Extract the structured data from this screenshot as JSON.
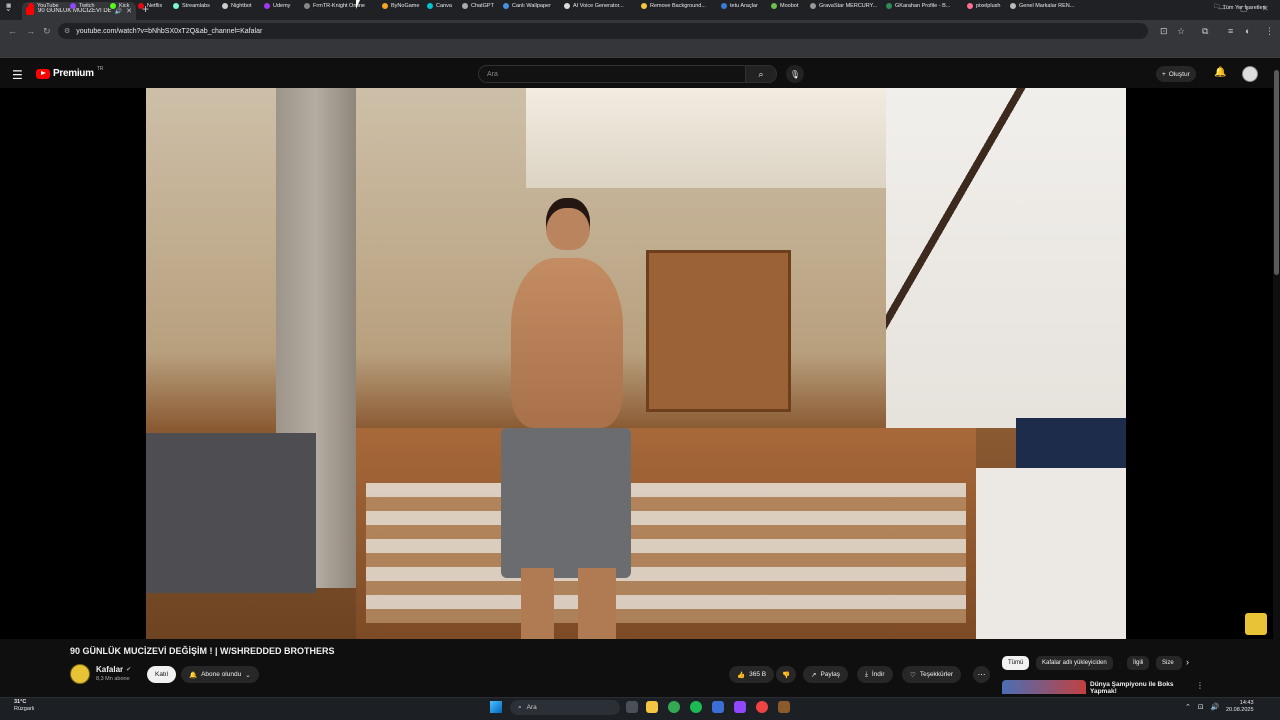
{
  "browser": {
    "tab_title": "90 GÜNLÜK MUCİZEVİ DE...",
    "new_tab": "+",
    "url": "youtube.com/watch?v=bNhbSX0xT2Q&ab_channel=Kafalar",
    "bookmarks": [
      {
        "label": "YouTube",
        "color": "#ff0000"
      },
      {
        "label": "Twitch",
        "color": "#9146ff"
      },
      {
        "label": "Kick",
        "color": "#53fc18"
      },
      {
        "label": "Netflix",
        "color": "#e50914"
      },
      {
        "label": "Streamlabs",
        "color": "#80f5d2"
      },
      {
        "label": "Nightbot",
        "color": "#cccccc"
      },
      {
        "label": "Udemy",
        "color": "#a435f0"
      },
      {
        "label": "FrmTR-Knight Online",
        "color": "#888888"
      },
      {
        "label": "ByNoGame",
        "color": "#f5a623"
      },
      {
        "label": "Canva",
        "color": "#00c4cc"
      },
      {
        "label": "ChatGPT",
        "color": "#aaaaaa"
      },
      {
        "label": "Canlı Wallpaper",
        "color": "#4a90e2"
      },
      {
        "label": "AI Voice Generator...",
        "color": "#dddddd"
      },
      {
        "label": "Remove Background...",
        "color": "#f5c542"
      },
      {
        "label": "tetu Araçlar",
        "color": "#3a7bd5"
      },
      {
        "label": "Moobot",
        "color": "#6cbf4c"
      },
      {
        "label": "GravaStar MERCURY...",
        "color": "#999999"
      },
      {
        "label": "GKarahan Profile - B...",
        "color": "#2e8b57"
      },
      {
        "label": "pixelplush",
        "color": "#ff6f91"
      },
      {
        "label": "Genel Markalar REN...",
        "color": "#bbbbbb"
      }
    ],
    "all_bookmarks": "Tüm Yer İşaretleri"
  },
  "youtube": {
    "logo_word": "Premium",
    "logo_region": "TR",
    "search_placeholder": "Ara",
    "create_label": "Oluştur",
    "video_title": "90 GÜNLÜK MUCİZEVİ DEĞİŞİM ! | W/SHREDDED BROTHERS",
    "channel_name": "Kafalar",
    "subscribers": "8,3 Mn abone",
    "join_label": "Katıl",
    "subscribed_label": "Abone olundu",
    "likes": "365 B",
    "share_label": "Paylaş",
    "download_label": "İndir",
    "thanks_label": "Teşekkürler",
    "chips": [
      "Tümü",
      "Kafalar adlı yükleyiciden",
      "İlgili",
      "Size"
    ],
    "recommended_title": "Dünya Şampiyonu ile Boks Yapmak!"
  },
  "taskbar": {
    "temperature": "31°C",
    "weather_label": "Rüzgarlı",
    "search_label": "Ara",
    "time": "14:43",
    "date": "20.08.2025"
  }
}
